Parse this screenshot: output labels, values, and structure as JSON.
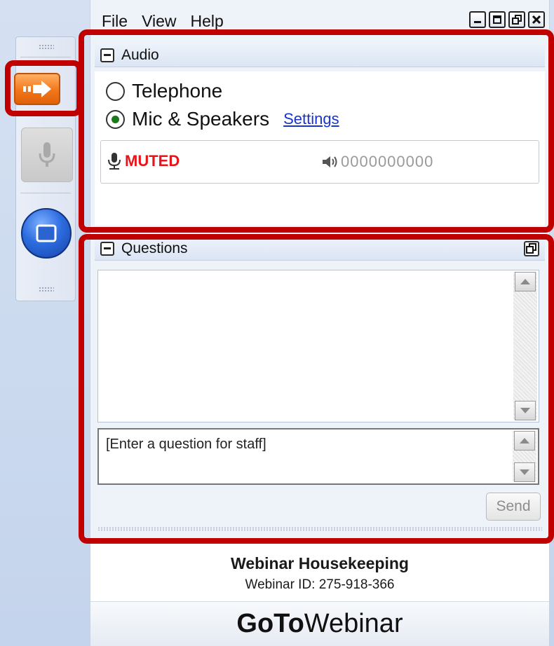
{
  "menubar": {
    "items": [
      "File",
      "View",
      "Help"
    ]
  },
  "window_controls": [
    "minimize",
    "maximize",
    "restore",
    "close"
  ],
  "toolbar": {
    "icons": [
      "grip-icon",
      "arrow-right-icon",
      "microphone-icon",
      "screen-icon",
      "grip-icon"
    ]
  },
  "audio": {
    "title": "Audio",
    "options": [
      "Telephone",
      "Mic & Speakers"
    ],
    "selected": "Mic & Speakers",
    "settings_label": "Settings",
    "mute_status": "MUTED",
    "level_readout": "0000000000"
  },
  "questions": {
    "title": "Questions",
    "input_placeholder": "[Enter a question for staff]",
    "send_label": "Send"
  },
  "footer": {
    "title": "Webinar Housekeeping",
    "webinar_id": "Webinar ID: 275-918-366"
  },
  "logo": {
    "bold": "GoTo",
    "regular": "Webinar"
  },
  "colors": {
    "highlight": "#c00000",
    "muted": "#e8141a",
    "link": "#1a33c9",
    "accent_orange": "#f2761a"
  }
}
